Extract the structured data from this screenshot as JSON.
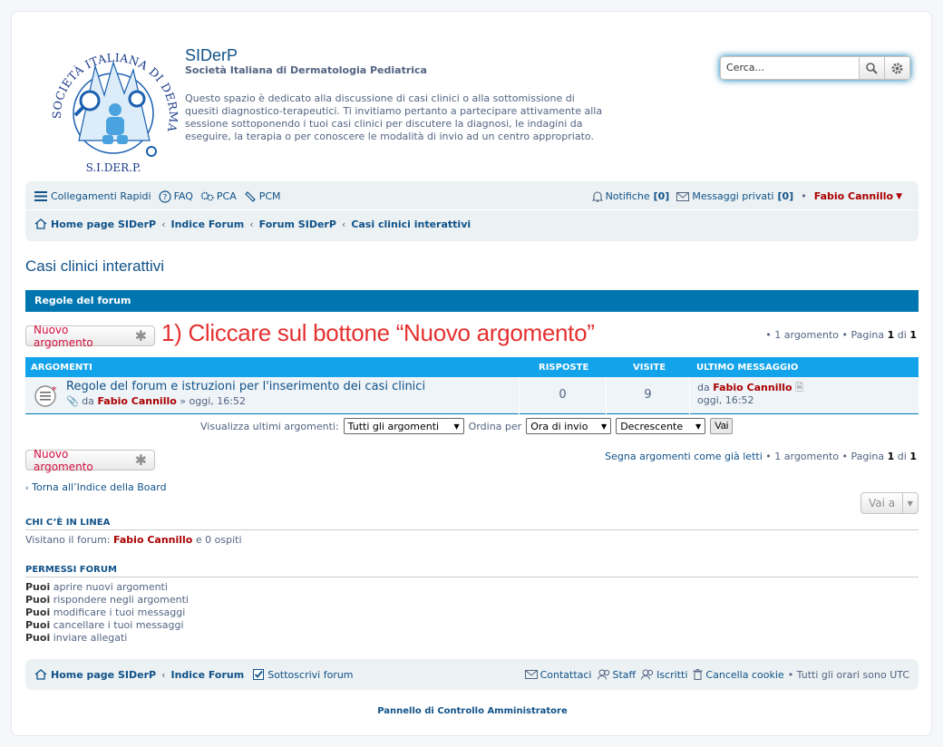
{
  "header": {
    "site_title": "SIDerP",
    "site_subtitle": "Società Italiana di Dermatologia Pediatrica",
    "description": "Questo spazio è dedicato alla discussione di casi clinici o alla sottomissione di quesiti diagnostico-terapeutici. Ti invitiamo pertanto a partecipare attivamente alla sessione sottoponendo i tuoi casi clinici per discutere la diagnosi, le indagini da eseguire, la terapia o per conoscere le modalità di invio ad un centro appropriato.",
    "logo_text": "SOCIETÀ ITALIANA DI DERMATOLOGIA PEDIATRICA",
    "logo_abbr": "S.I.DER.P."
  },
  "search": {
    "placeholder": "Cerca..."
  },
  "navbar": {
    "quick_links": "Collegamenti Rapidi",
    "faq": "FAQ",
    "pca": "PCA",
    "pcm": "PCM",
    "notifications": "Notifiche",
    "notifications_count": "[0]",
    "private_messages": "Messaggi privati",
    "private_messages_count": "[0]",
    "username": "Fabio Cannillo"
  },
  "breadcrumb": [
    "Home page SIDerP",
    "Indice Forum",
    "Forum SIDerP",
    "Casi clinici interattivi"
  ],
  "forum_title": "Casi clinici interattivi",
  "rules_label": "Regole del forum",
  "new_topic_label": "Nuovo argomento",
  "annotation": "1) Cliccare sul bottone “Nuovo argomento”",
  "pagination_top": {
    "prefix": "• 1 argomento • Pagina",
    "page": "1",
    "of": "di",
    "total": "1"
  },
  "pagination_bottom": {
    "mark_read": "Segna argomenti come già letti",
    "prefix": "• 1 argomento • Pagina",
    "page": "1",
    "of": "di",
    "total": "1"
  },
  "table": {
    "headers": {
      "topics": "Argomenti",
      "replies": "Risposte",
      "views": "Visite",
      "last_post": "Ultimo messaggio"
    },
    "rows": [
      {
        "title": "Regole del forum e istruzioni per l'inserimento dei casi clinici",
        "by": "da",
        "author": "Fabio Cannillo",
        "time": "» oggi, 16:52",
        "replies": "0",
        "views": "9",
        "last_by": "da",
        "last_author": "Fabio Cannillo",
        "last_time": "oggi, 16:52"
      }
    ]
  },
  "filter": {
    "show_label": "Visualizza ultimi argomenti:",
    "show_value": "Tutti gli argomenti",
    "sort_label": "Ordina per",
    "sort_value": "Ora di invio",
    "order_value": "Decrescente",
    "go_label": "Vai"
  },
  "back_link": "Torna all’Indice della Board",
  "jump_label": "Vai a",
  "online": {
    "heading": "CHI C’È IN LINEA",
    "prefix": "Visitano il forum:",
    "user": "Fabio Cannillo",
    "suffix": "e 0 ospiti"
  },
  "permissions": {
    "heading": "PERMESSI FORUM",
    "can": "Puoi",
    "items": [
      "aprire nuovi argomenti",
      "rispondere negli argomenti",
      "modificare i tuoi messaggi",
      "cancellare i tuoi messaggi",
      "inviare allegati"
    ]
  },
  "footer": {
    "home": "Home page SIDerP",
    "index": "Indice Forum",
    "subscribe": "Sottoscrivi forum",
    "contact": "Contattaci",
    "staff": "Staff",
    "members": "Iscritti",
    "delete_cookies": "Cancella cookie",
    "timezone": "• Tutti gli orari sono UTC"
  },
  "acp_link": "Pannello di Controllo Amministratore",
  "colors": {
    "link": "#105289",
    "user": "#aa0000",
    "header_bar": "#0076b1",
    "table_head": "#12a3eb",
    "annotation": "#e53030",
    "new_topic": "#d31141"
  }
}
